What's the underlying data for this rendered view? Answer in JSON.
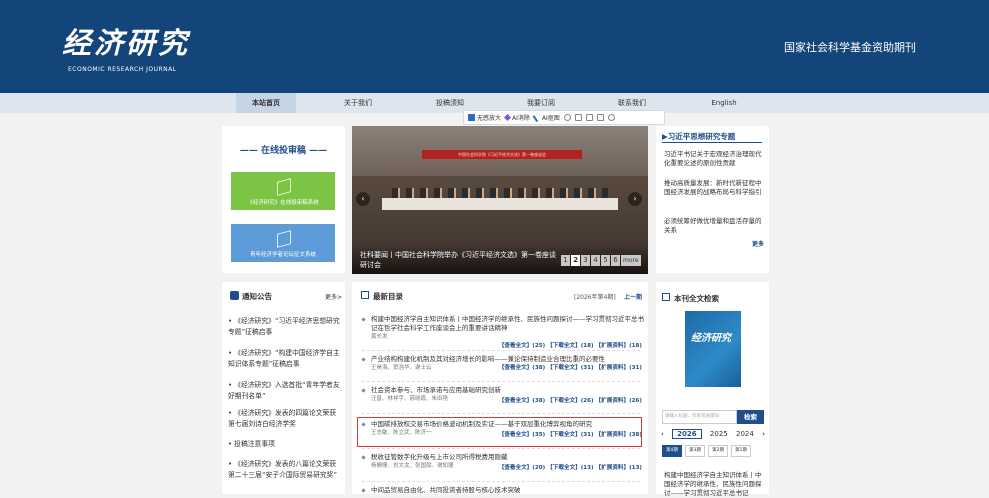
{
  "header": {
    "logo_title": "经济研究",
    "logo_subtitle": "ECONOMIC RESEARCH JOURNAL",
    "tagline": "国家社会科学基金资助期刊"
  },
  "nav": {
    "items": [
      {
        "label": "本站首页",
        "active": true
      },
      {
        "label": "关于我们"
      },
      {
        "label": "投稿须知"
      },
      {
        "label": "我要订阅"
      },
      {
        "label": "联系我们"
      },
      {
        "label": "English"
      }
    ]
  },
  "toolbar": {
    "magnify": "无感放大",
    "ai_eraser": "AI消除",
    "ai_cutout": "AI抠图"
  },
  "online": {
    "title": "—— 在线投审稿 ——",
    "green_button": "《经济研究》在线投审稿系统",
    "blue_button": "青年经济学者论坛征文系统"
  },
  "carousel": {
    "banner": "中国社会科学院《习近平经济文选》第一卷座谈会",
    "caption": "社科要闻丨中国社会科学院举办《习近平经济文选》第一卷座谈研讨会",
    "pages": [
      "1",
      "2",
      "3",
      "4",
      "5",
      "6"
    ],
    "more": "more"
  },
  "xi_section": {
    "title": "习近平思想研究专题",
    "items": [
      "习近平书记关于宏观经济治理现代化重要论述的原创性贡献",
      "推动高质量发展：新时代新征程中国经济发展的战略布局与科学指引",
      "必须统筹好做优增量和盘活存量的关系"
    ],
    "more": "更多"
  },
  "notice": {
    "title": "通知公告",
    "more": "更多>",
    "items": [
      "《经济研究》“习近平经济思想研究专题”征稿启事",
      "《经济研究》“构建中国经济学自主知识体系专题”征稿启事",
      "《经济研究》入选首批“青年学者友好期刊名单”",
      "《经济研究》发表的四篇论文荣获第七届刘诗白经济学奖",
      "投稿注意事项",
      "《经济研究》发表的八篇论文荣获第二十三届“安子介国际贸易研究奖”"
    ]
  },
  "articles": {
    "title": "最新目录",
    "issue": "[2026年第4期]",
    "prev": "上一期",
    "items": [
      {
        "title": "构建中国经济学自主知识体系丨中国经济学的继承性、民族性问题探讨——学习贯彻习近平总书记在哲学社会科学工作座谈会上的重要讲话精神",
        "authors": "黄长发",
        "links": "【查看全文】(25)  【下载全文】(18)  【扩展资料】(18)"
      },
      {
        "title": "产业结构构建化机制及其对经济增长的影响——兼论保持制造业合理比重的必要性",
        "authors": "王昊海、贺浩华、谢士云",
        "links": "【查看全文】(38)  【下载全文】(31)  【扩展资料】(31)"
      },
      {
        "title": "社会资本参与、市场承诺与应用基础研究创新",
        "authors": "汪普、林祥宇、慈晓霞、朱田艳",
        "links": "【查看全文】(38)  【下载全文】(26)  【扩展资料】(26)"
      },
      {
        "title": "中国碳排放权交易市场价格波动机制及实证——基于双层重化博弈视角的研究",
        "authors": "王志敏、陈立武、陈济一",
        "links": "【查看全文】(35)  【下载全文】(31)  【扩展资料】(38)"
      },
      {
        "title": "税收征管数字化升级与上市公司所得税费用隐藏",
        "authors": "杨姗姗、刘文龙、张国斌、谢知捷",
        "links": "【查看全文】(20)  【下载全文】(13)  【扩展资料】(13)"
      },
      {
        "title": "中间品贸易自由化、共同投资者持股与核心技术突破",
        "authors": "",
        "links": ""
      }
    ]
  },
  "search": {
    "title": "本刊全文检索",
    "cover_title": "经济研究",
    "input_placeholder": "请输入标题、作者或关键词",
    "button": "检索",
    "years": [
      "2026",
      "2025",
      "2024"
    ],
    "issues": [
      "第4期",
      "第3期",
      "第2期",
      "第1期"
    ],
    "article": "构建中国经济学自主知识体系丨中国经济学的继承性、民族性问题探讨——学习贯彻习近平总书记"
  }
}
